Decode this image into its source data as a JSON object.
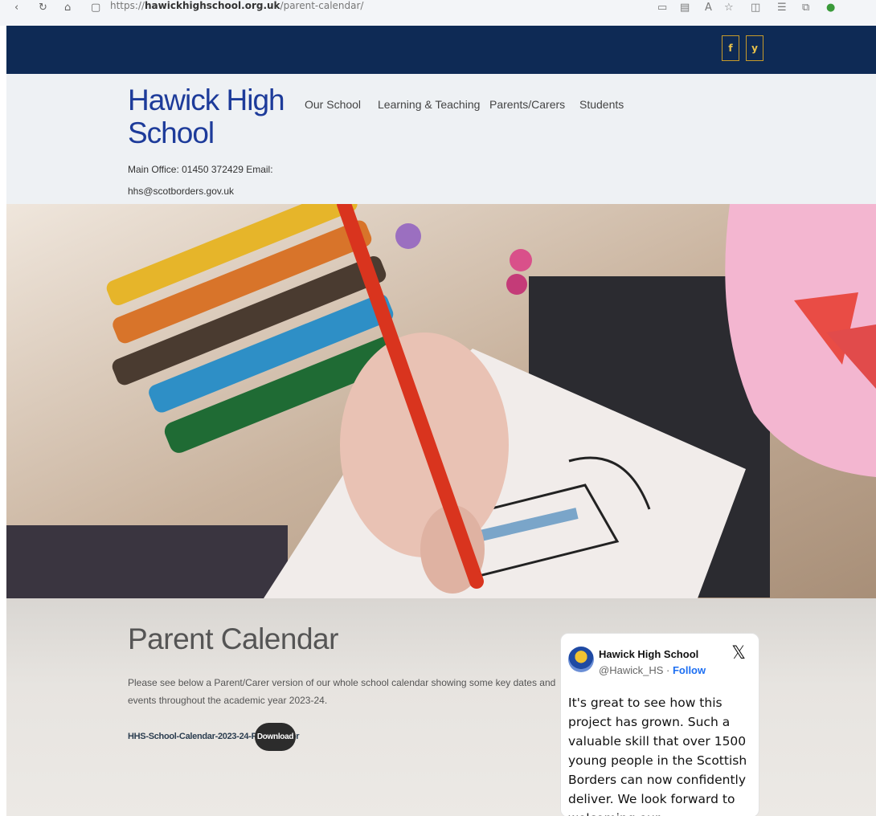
{
  "browser": {
    "url_prefix": "https://",
    "url_domain": "hawickhighschool.org.uk",
    "url_path": "/parent-calendar/"
  },
  "social": {
    "facebook_label": "f",
    "twitter_label": "y",
    "accent_color": "#c79a2a"
  },
  "header": {
    "school_name_line1": "Hawick High",
    "school_name_line2": "School",
    "contact_line1": "Main Office: 01450 372429 Email:",
    "contact_line2": "hhs@scotborders.gov.uk",
    "nav": [
      "Our School",
      "Learning & Teaching",
      "Parents/Carers",
      "Students"
    ]
  },
  "colors": {
    "topbar": "#0e2a55",
    "brand": "#1d3b9a"
  },
  "main": {
    "title": "Parent Calendar",
    "intro": "Please see below a Parent/Carer version of our whole school calendar showing some key dates and events throughout the academic year 2023-24.",
    "file_name": "HHS-School-Calendar-2023-24-ParentCarer",
    "download_label": "Download"
  },
  "tweet": {
    "name": "Hawick High School",
    "handle": "@Hawick_HS",
    "separator": " · ",
    "follow_label": "Follow",
    "logo": "𝕏",
    "text": "It's great to see how this project has grown. Such a valuable skill that over 1500 young people in the Scottish Borders can now confidently deliver. We look forward to welcoming our"
  }
}
